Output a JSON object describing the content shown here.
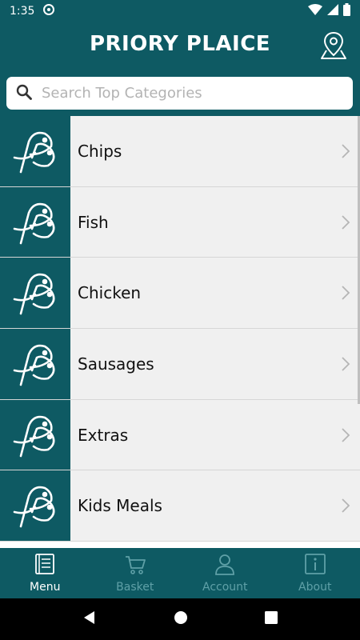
{
  "status_bar": {
    "time": "1:35"
  },
  "header": {
    "title": "PRIORY PLAICE",
    "location_icon": "map-pin-icon"
  },
  "search": {
    "placeholder": "Search Top Categories",
    "value": ""
  },
  "categories": [
    {
      "label": "Chips"
    },
    {
      "label": "Fish"
    },
    {
      "label": "Chicken"
    },
    {
      "label": "Sausages"
    },
    {
      "label": "Extras"
    },
    {
      "label": "Kids Meals"
    }
  ],
  "bottom_nav": [
    {
      "label": "Menu",
      "icon": "menu-book-icon",
      "active": true
    },
    {
      "label": "Basket",
      "icon": "cart-icon",
      "active": false
    },
    {
      "label": "Account",
      "icon": "user-icon",
      "active": false
    },
    {
      "label": "About",
      "icon": "info-icon",
      "active": false
    }
  ],
  "colors": {
    "primary": "#0e5a63",
    "row_bg": "#f0f0f0",
    "inactive_nav": "#5fa0a7"
  }
}
